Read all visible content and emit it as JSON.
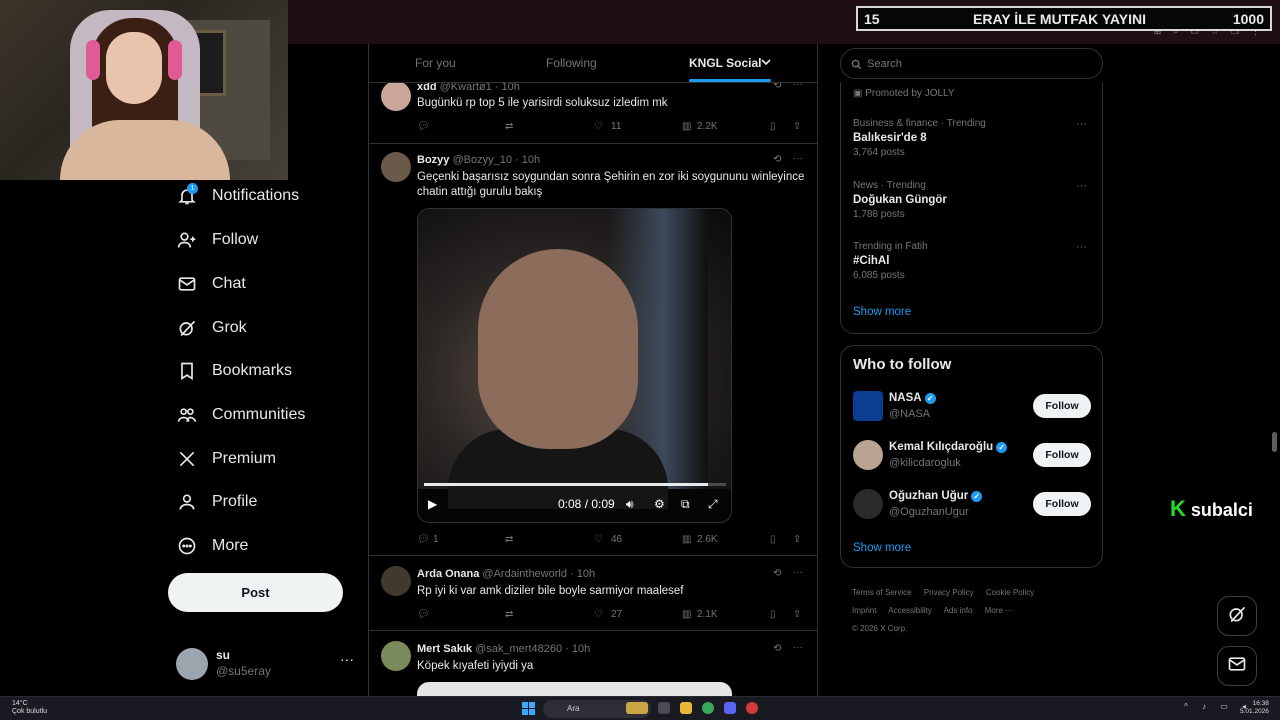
{
  "overlay": {
    "left_number": "15",
    "title": "ERAY İLE MUTFAK YAYINI",
    "right_number": "1000"
  },
  "nav": {
    "notifications_badge": "1",
    "items": [
      {
        "label": "Notifications",
        "icon": "bell-icon"
      },
      {
        "label": "Follow",
        "icon": "person-add-icon"
      },
      {
        "label": "Chat",
        "icon": "envelope-icon"
      },
      {
        "label": "Grok",
        "icon": "grok-icon"
      },
      {
        "label": "Bookmarks",
        "icon": "bookmark-icon"
      },
      {
        "label": "Communities",
        "icon": "people-icon"
      },
      {
        "label": "Premium",
        "icon": "x-logo-icon"
      },
      {
        "label": "Profile",
        "icon": "person-icon"
      },
      {
        "label": "More",
        "icon": "more-circle-icon"
      }
    ],
    "post_label": "Post"
  },
  "account": {
    "name": "su",
    "handle": "@su5eray"
  },
  "tabs": [
    {
      "label": "For you",
      "active": false
    },
    {
      "label": "Following",
      "active": false
    },
    {
      "label": "KNGL Social",
      "active": true
    }
  ],
  "tweets": [
    {
      "name": "xdd",
      "handle": "@Kwartø1",
      "time": "10h",
      "text": "Bugünkü rp top 5 ile yarisirdi soluksuz izledim mk",
      "replies": "",
      "reposts": "",
      "likes": "11",
      "views": "2.2K"
    },
    {
      "name": "Bozyy",
      "handle": "@Bozyy_10",
      "time": "10h",
      "text": "Geçenki başarısız soygundan sonra Şehirin en zor iki soygununu winleyince chatin attığı gurulu bakış",
      "replies": "1",
      "reposts": "",
      "likes": "46",
      "views": "2.6K"
    },
    {
      "name": "Arda Onana",
      "handle": "@Ardaintheworld",
      "time": "10h",
      "text": "Rp iyi ki var amk diziler bile boyle sarmiyor maalesef",
      "replies": "",
      "reposts": "",
      "likes": "27",
      "views": "2.1K"
    },
    {
      "name": "Mert Sakık",
      "handle": "@sak_mert48260",
      "time": "10h",
      "text": "Köpek kıyafeti iyiydi ya",
      "replies": "",
      "reposts": "",
      "likes": "",
      "views": ""
    }
  ],
  "video": {
    "time": "0:08 / 0:09",
    "progress": 0.94
  },
  "search": {
    "placeholder": "Search"
  },
  "trends": {
    "promoted": "Promoted by JOLLY",
    "items": [
      {
        "category": "Business & finance · Trending",
        "title": "Balıkesir'de 8",
        "count": "3,764 posts"
      },
      {
        "category": "News · Trending",
        "title": "Doğukan Güngör",
        "count": "1,788 posts"
      },
      {
        "category": "Trending in Fatih",
        "title": "#CihAl",
        "count": "6,085 posts"
      }
    ],
    "show_more": "Show more"
  },
  "who_to_follow": {
    "title": "Who to follow",
    "items": [
      {
        "name": "NASA",
        "handle": "@NASA",
        "button": "Follow"
      },
      {
        "name": "Kemal Kılıçdaroğlu",
        "handle": "@kilicdarogluk",
        "button": "Follow"
      },
      {
        "name": "Oğuzhan Uğur",
        "handle": "@OguzhanUgur",
        "button": "Follow"
      }
    ],
    "show_more": "Show more"
  },
  "footer": {
    "links": [
      "Terms of Service",
      "Privacy Policy",
      "Cookie Policy",
      "Imprint",
      "Accessibility",
      "Ads info",
      "More ···"
    ],
    "copyright": "© 2026 X Corp."
  },
  "watermark": {
    "k": "K",
    "text": "subalci"
  },
  "taskbar": {
    "temp": "14°C",
    "weather": "Çok bulutlu",
    "search": "Ara",
    "time": "16:38",
    "date": "5.01.2026"
  },
  "colors": {
    "accent": "#1d9bf0",
    "background": "#000000",
    "text": "#e7e9ea",
    "muted": "#71767b"
  }
}
